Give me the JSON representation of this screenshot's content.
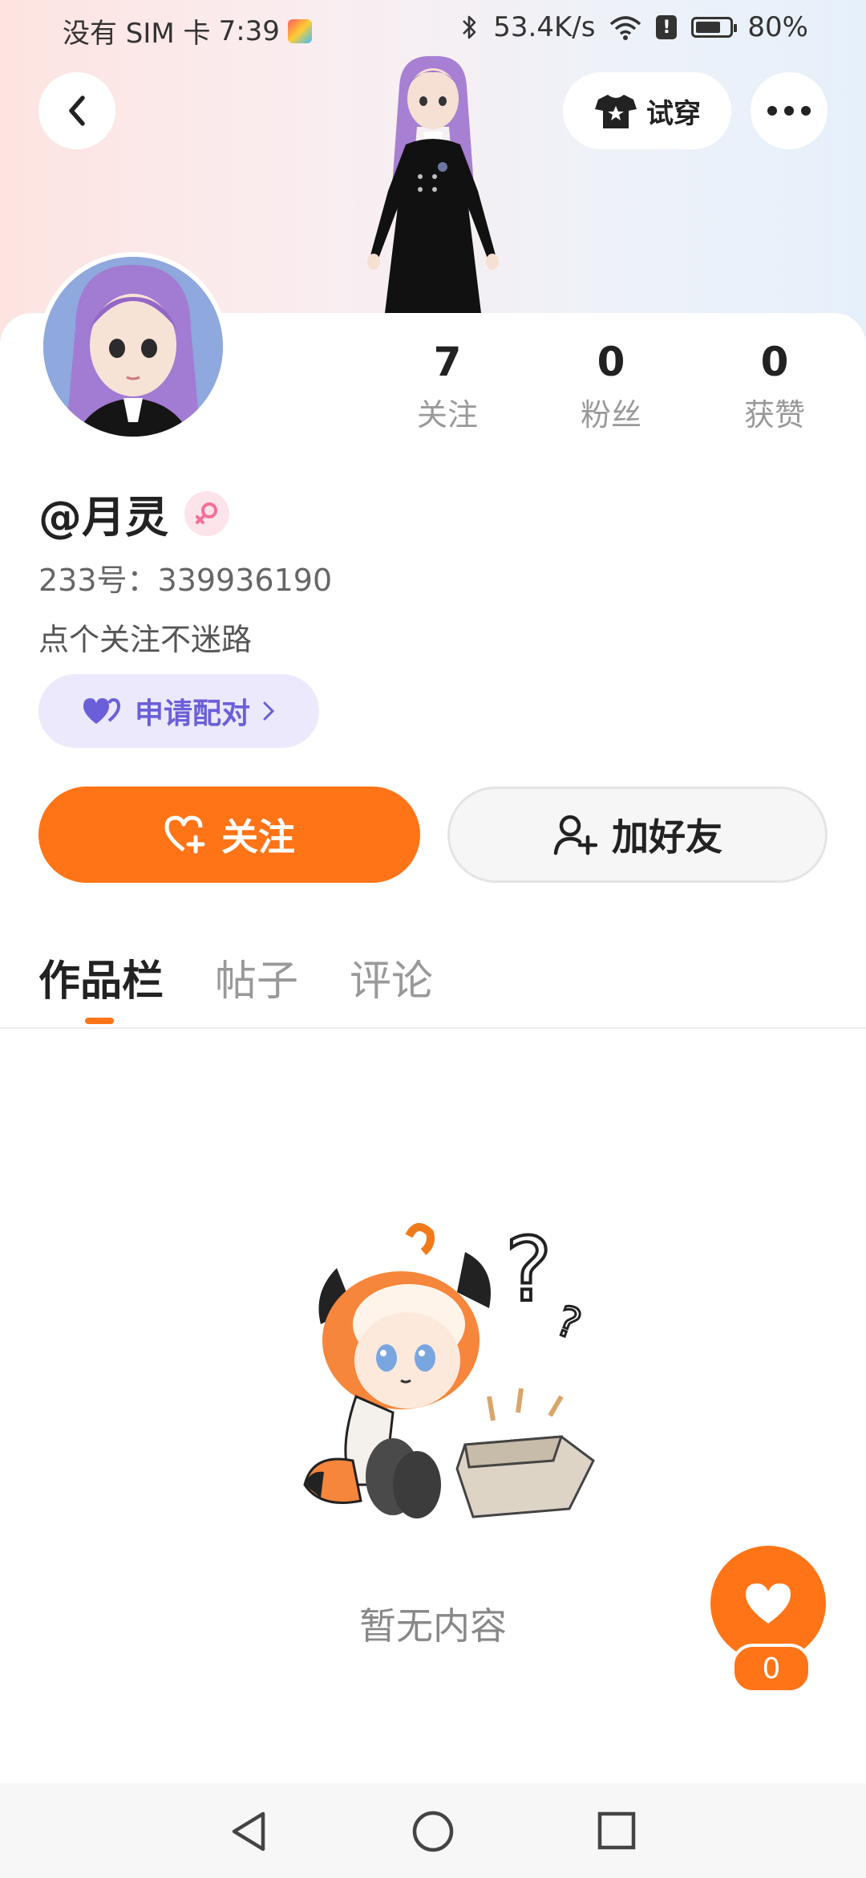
{
  "status_bar": {
    "carrier": "没有 SIM 卡",
    "time": "7:39",
    "speed": "53.4K/s",
    "battery": "80%"
  },
  "header": {
    "back_icon": "chevron-left-icon",
    "tryon_label": "试穿",
    "more_icon": "more-dots-icon"
  },
  "profile": {
    "stats": [
      {
        "value": "7",
        "label": "关注"
      },
      {
        "value": "0",
        "label": "粉丝"
      },
      {
        "value": "0",
        "label": "获赞"
      }
    ],
    "username": "@月灵",
    "uid": "233号：339936190",
    "bio": "点个关注不迷路",
    "match_label": "申请配对",
    "follow_label": "关注",
    "add_friend_label": "加好友"
  },
  "tabs": [
    {
      "label": "作品栏",
      "active": true
    },
    {
      "label": "帖子",
      "active": false
    },
    {
      "label": "评论",
      "active": false
    }
  ],
  "empty": {
    "text": "暂无内容"
  },
  "like": {
    "count": "0"
  },
  "colors": {
    "accent": "#ff7417",
    "match": "#6b5fd9"
  }
}
